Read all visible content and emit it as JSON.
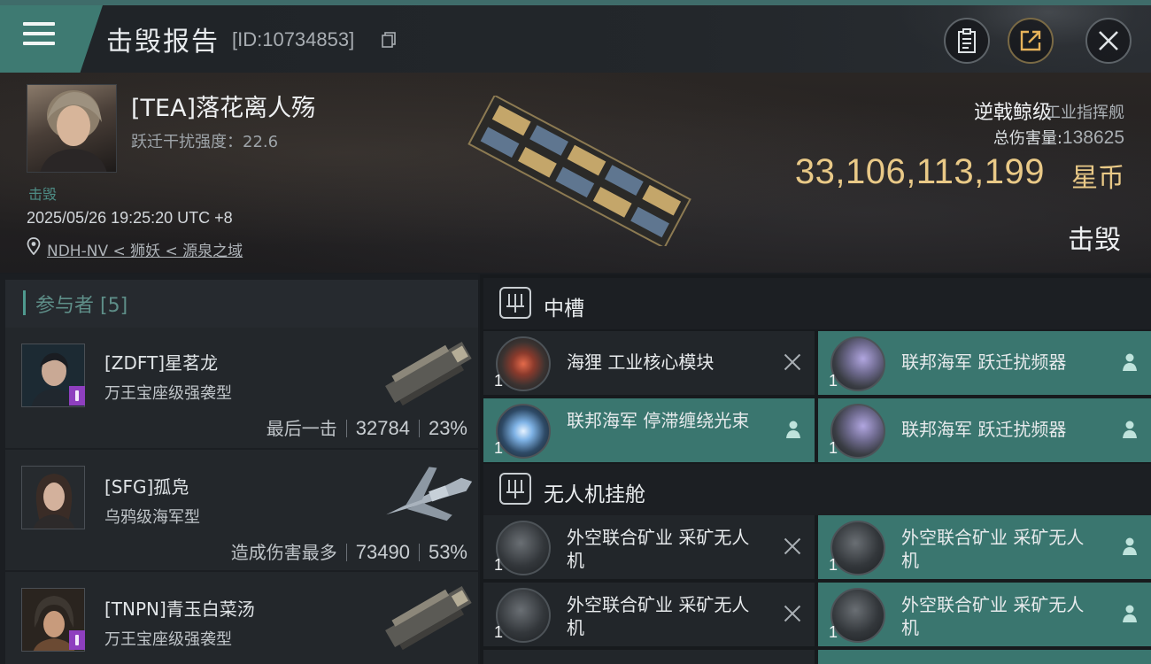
{
  "header": {
    "title": "击毁报告",
    "report_id": "[ID:10734853]",
    "icons": [
      "menu-icon",
      "copy-icon",
      "clipboard-icon",
      "share-icon",
      "close-icon"
    ]
  },
  "victim": {
    "name": "[TEA]落花离人殇",
    "scram_strength": "跃迁干扰强度：22.6",
    "status": "击毁",
    "time": "2025/05/26 19:25:20 UTC +8",
    "location": "NDH-NV < 狮妖 < 源泉之域",
    "ship_class": "逆戟鲸级",
    "ship_role": "工业指挥舰",
    "damage_label": "总伤害量:",
    "damage_value": "138625",
    "isk_value": "33,106,113,199",
    "isk_unit": "星币",
    "result_label": "击毁"
  },
  "participants": {
    "title": "参与者 [5]",
    "list": [
      {
        "name": "[ZDFT]星茗龙",
        "ship": "万王宝座级强袭型",
        "tag": "最后一击",
        "damage": "32784",
        "percent": "23%"
      },
      {
        "name": "[SFG]孤凫",
        "ship": "乌鸦级海军型",
        "tag": "造成伤害最多",
        "damage": "73490",
        "percent": "53%"
      },
      {
        "name": "[TNPN]青玉白菜汤",
        "ship": "万王宝座级强袭型",
        "tag": "",
        "damage": "",
        "percent": ""
      }
    ]
  },
  "fitting": {
    "mid_slot": {
      "title": "中槽",
      "modules": [
        {
          "name": "海狸 工业核心模块",
          "qty": "1",
          "state": "destroyed"
        },
        {
          "name": "联邦海军 跃迁扰频器",
          "qty": "1",
          "state": "dropped"
        },
        {
          "name": "联邦海军 停滞缠绕光束",
          "qty": "1",
          "state": "dropped"
        },
        {
          "name": "联邦海军 跃迁扰频器",
          "qty": "1",
          "state": "dropped"
        }
      ]
    },
    "drone_bay": {
      "title": "无人机挂舱",
      "modules": [
        {
          "name": "外空联合矿业 采矿无人机",
          "qty": "1",
          "state": "destroyed"
        },
        {
          "name": "外空联合矿业 采矿无人机",
          "qty": "1",
          "state": "dropped"
        },
        {
          "name": "外空联合矿业 采矿无人机",
          "qty": "1",
          "state": "destroyed"
        },
        {
          "name": "外空联合矿业 采矿无人机",
          "qty": "1",
          "state": "dropped"
        }
      ]
    }
  },
  "colors": {
    "accent": "#3e7a72",
    "isk": "#e9c987",
    "badge": "#8e3fbf"
  }
}
